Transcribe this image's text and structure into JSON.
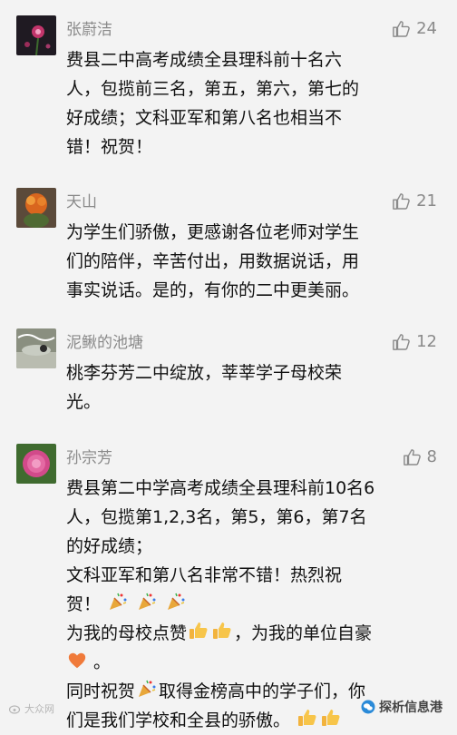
{
  "comments": [
    {
      "name": "张蔚洁",
      "likes": "24",
      "lines": [
        "费县二中高考成绩全县理科前十名六",
        "人，包揽前三名，第五，第六，第七的",
        "好成绩；文科亚军和第八名也相当不",
        "错！祝贺！"
      ]
    },
    {
      "name": "天山",
      "likes": "21",
      "lines": [
        "为学生们骄傲，更感谢各位老师对学生",
        "们的陪伴，辛苦付出，用数据说话，用",
        "事实说话。是的，有你的二中更美丽。"
      ]
    },
    {
      "name": "泥鳅的池塘",
      "likes": "12",
      "lines": [
        "桃李芬芳二中绽放，莘莘学子母校荣",
        "光。"
      ]
    },
    {
      "name": "孙宗芳",
      "likes": "8",
      "lines": {
        "l1": "费县第二中学高考成绩全县理科前10名6",
        "l2": "人，包揽第1,2,3名，第5，第6，第7名",
        "l3": "的好成绩；",
        "l4": "文科亚军和第八名非常不错！热烈祝",
        "l5": "贺！",
        "l6a": "为我的母校点赞",
        "l6b": "，为我的单位自豪",
        "l8": "。",
        "l9a": "同时祝贺",
        "l9b": "取得金榜高中的学子们，你",
        "l10": "们是我们学校和全县的骄傲。"
      }
    }
  ],
  "watermark_left": "大众网",
  "watermark_right": "探析信息港"
}
